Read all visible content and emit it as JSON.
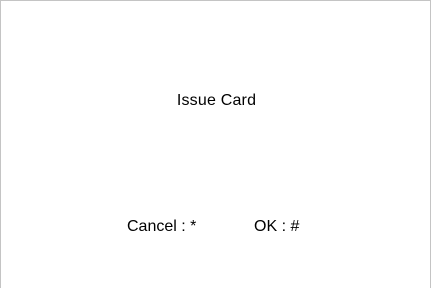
{
  "screen": {
    "title": "Issue Card",
    "prompts": {
      "cancel_label": "Cancel : *",
      "ok_label": "OK : #"
    }
  }
}
